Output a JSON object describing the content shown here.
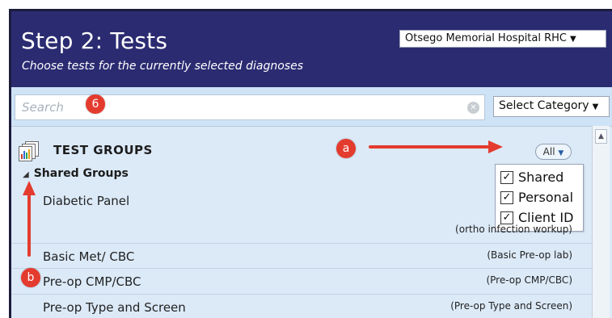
{
  "header": {
    "title": "Step 2: Tests",
    "subtitle": "Choose tests for the currently selected diagnoses",
    "facility": "Otsego Memorial Hospital RHC"
  },
  "search": {
    "placeholder": "Search",
    "category": "Select Category"
  },
  "groups": {
    "title": "TEST GROUPS",
    "filter_label": "All",
    "filter_options": [
      {
        "label": "Shared",
        "checked": true
      },
      {
        "label": "Personal",
        "checked": true
      },
      {
        "label": "Client ID",
        "checked": true
      }
    ],
    "section": "Shared Groups"
  },
  "rows": [
    {
      "name": "Diabetic Panel",
      "tag": ""
    },
    {
      "name": "",
      "tag": "(ortho infection workup)"
    },
    {
      "name": "Basic Met/ CBC",
      "tag": "(Basic Pre-op lab)"
    },
    {
      "name": "Pre-op CMP/CBC",
      "tag": "(Pre-op CMP/CBC)"
    },
    {
      "name": "Pre-op Type and Screen",
      "tag": "(Pre-op Type and Screen)"
    }
  ],
  "annotations": {
    "search_marker": "6",
    "filter_marker": "a",
    "collapse_marker": "b",
    "color": "#e43b2f"
  },
  "colors": {
    "header_bg": "#2b2b72",
    "panel_bg": "#dceaf8"
  }
}
